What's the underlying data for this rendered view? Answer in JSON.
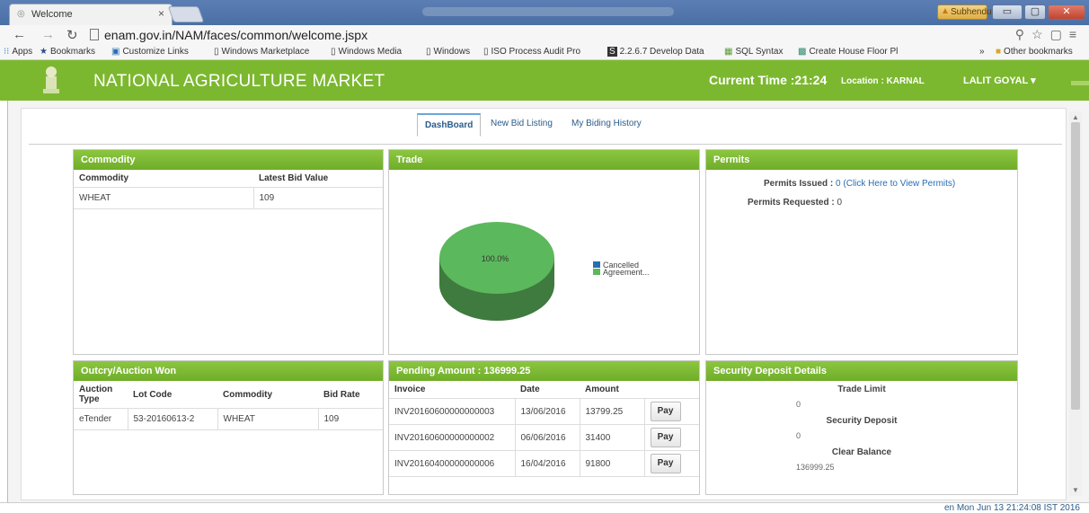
{
  "browser": {
    "tab_title": "Welcome",
    "tab_close": "×",
    "url": "enam.gov.in/NAM/faces/common/welcome.jspx",
    "user_badge": "Subhendu",
    "bookmarks": [
      {
        "label": "Apps",
        "icon": "apps-icon"
      },
      {
        "label": "Bookmarks",
        "icon": "star-icon"
      },
      {
        "label": "Customize Links",
        "icon": "link-icon"
      },
      {
        "label": "Windows Marketplace",
        "icon": "page-icon"
      },
      {
        "label": "Windows Media",
        "icon": "page-icon"
      },
      {
        "label": "Windows",
        "icon": "page-icon"
      },
      {
        "label": "ISO Process Audit Pro",
        "icon": "page-icon"
      },
      {
        "label": "2.2.6.7 Develop Data",
        "icon": "s-icon"
      },
      {
        "label": "SQL Syntax",
        "icon": "sql-icon"
      },
      {
        "label": "Create House Floor Pl",
        "icon": "house-icon"
      },
      {
        "label": "»",
        "icon": ""
      },
      {
        "label": "Other bookmarks",
        "icon": "folder-icon"
      }
    ]
  },
  "header": {
    "title": "NATIONAL AGRICULTURE MARKET",
    "current_time": "Current Time :21:24",
    "location": "Location : KARNAL",
    "user": "LALIT GOYAL ▾",
    "color": "#7cb82f"
  },
  "tabs": [
    {
      "label": "DashBoard",
      "active": true
    },
    {
      "label": "New Bid Listing",
      "active": false
    },
    {
      "label": "My Biding History",
      "active": false
    }
  ],
  "commodity": {
    "title": "Commodity",
    "columns": [
      "Commodity",
      "Latest Bid Value"
    ],
    "rows": [
      [
        "WHEAT",
        "109"
      ]
    ]
  },
  "trade": {
    "title": "Trade",
    "chart_data": {
      "type": "pie",
      "categories": [
        "Cancelled",
        "Agreement..."
      ],
      "values": [
        0,
        100
      ],
      "data_label": "100.0%",
      "colors": [
        "#2a6db5",
        "#5cb85c"
      ],
      "legend_position": "right"
    }
  },
  "permits": {
    "title": "Permits",
    "issued_label": "Permits Issued :",
    "issued_value": "0 (Click Here to View Permits)",
    "requested_label": "Permits Requested :",
    "requested_value": "0"
  },
  "auction": {
    "title": "Outcry/Auction Won",
    "columns": [
      "Auction Type",
      "Lot Code",
      "Commodity",
      "Bid Rate"
    ],
    "rows": [
      [
        "eTender",
        "53-20160613-2",
        "WHEAT",
        "109"
      ]
    ]
  },
  "pending": {
    "title": "Pending Amount : 136999.25",
    "columns": [
      "Invoice",
      "Date",
      "Amount",
      ""
    ],
    "pay_label": "Pay",
    "rows": [
      [
        "INV20160600000000003",
        "13/06/2016",
        "13799.25"
      ],
      [
        "INV20160600000000002",
        "06/06/2016",
        "31400"
      ],
      [
        "INV20160400000000006",
        "16/04/2016",
        "91800"
      ]
    ]
  },
  "security": {
    "title": "Security Deposit Details",
    "trade_limit_label": "Trade Limit",
    "trade_limit_value": "0",
    "security_deposit_label": "Security Deposit",
    "security_deposit_value": "0",
    "clear_balance_label": "Clear Balance",
    "clear_balance_value": "136999.25"
  },
  "status": {
    "text": "en   Mon Jun 13 21:24:08 IST 2016"
  }
}
